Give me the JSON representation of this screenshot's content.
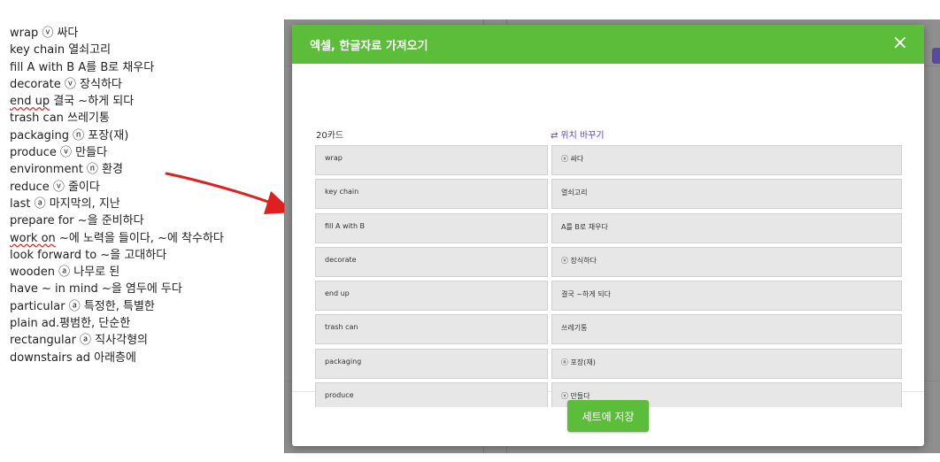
{
  "word_list": [
    "wrap ⓥ 싸다",
    "key chain 열쇠고리",
    "fill A with B A를 B로 채우다",
    "decorate ⓥ 장식하다",
    "end up 결국 ~하게 되다",
    "trash can 쓰레기통",
    "packaging ⓝ 포장(재)",
    "produce ⓥ 만들다",
    "environment ⓝ 환경",
    "reduce ⓥ 줄이다",
    "last ⓐ 마지막의, 지난",
    "prepare for ~을 준비하다",
    "work on ~에 노력을 들이다, ~에 착수하다",
    "look forward to ~을 고대하다",
    "wooden ⓐ 나무로 된",
    "have ~ in mind ~을 염두에 두다",
    "particular ⓐ 특정한, 특별한",
    "plain ad.평범한, 단순한",
    "rectangular ⓐ 직사각형의",
    "downstairs ad 아래층에"
  ],
  "modal": {
    "title": "엑셀, 한글자료 가져오기",
    "close": "×",
    "count_label": "20카드",
    "swap_label": "위치 바꾸기",
    "save_button": "세트에 저장",
    "rows": [
      {
        "term": "wrap",
        "definition": "ⓥ 싸다"
      },
      {
        "term": "key chain",
        "definition": "열쇠고리"
      },
      {
        "term": "fill A with B",
        "definition": "A를 B로 채우다"
      },
      {
        "term": "decorate",
        "definition": "ⓥ 장식하다"
      },
      {
        "term": "end up",
        "definition": "결국 ~하게 되다"
      },
      {
        "term": "trash can",
        "definition": "쓰레기통"
      },
      {
        "term": "packaging",
        "definition": "ⓝ 포장(재)"
      },
      {
        "term": "produce",
        "definition": "ⓥ 만들다"
      }
    ]
  },
  "colors": {
    "accent": "#5cbd3a",
    "link": "#5b4ac4",
    "arrow": "#e02020"
  },
  "icons": {
    "swap": "swap-arrows-icon",
    "close": "close-icon"
  }
}
